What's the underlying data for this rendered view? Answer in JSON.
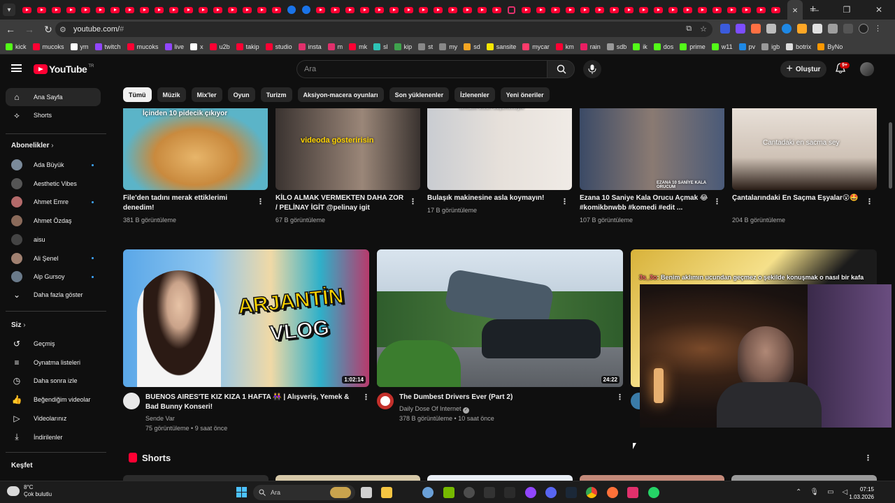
{
  "browser": {
    "url_host": "youtube.com/",
    "url_path": "#",
    "tab_count_favicons": 52,
    "active_tab_close": "×",
    "new_tab": "+",
    "bookmarks": [
      "kick",
      "mucoks",
      "ym",
      "twitch",
      "mucoks",
      "live",
      "x",
      "u2b",
      "takip",
      "studio",
      "insta",
      "m",
      "mk",
      "sl",
      "kip",
      "st",
      "my",
      "sd",
      "sansite",
      "mycar",
      "km",
      "rain",
      "sdb",
      "ik",
      "dos",
      "prime",
      "w11",
      "pv",
      "igb",
      "botrix",
      "ByNo"
    ]
  },
  "header": {
    "logo_text": "YouTube",
    "logo_country": "TR",
    "search_placeholder": "Ara",
    "create_label": "Oluştur",
    "notif_badge": "9+"
  },
  "chips": [
    "Tümü",
    "Müzik",
    "Mix'ler",
    "Oyun",
    "Turizm",
    "Aksiyon-macera oyunları",
    "Son yüklenenler",
    "İzlenenler",
    "Yeni öneriler"
  ],
  "sidebar": {
    "home": "Ana Sayfa",
    "shorts": "Shorts",
    "subs_heading": "Abonelikler",
    "subs": [
      {
        "name": "Ada Büyük",
        "dot": true
      },
      {
        "name": "Aesthetic Vibes",
        "dot": false
      },
      {
        "name": "Ahmet Emre",
        "dot": true
      },
      {
        "name": "Ahmet Özdaş",
        "dot": false
      },
      {
        "name": "aisu",
        "dot": false
      },
      {
        "name": "Ali Şenel",
        "dot": true
      },
      {
        "name": "Alp Gursoy",
        "dot": true
      }
    ],
    "show_more": "Daha fazla göster",
    "you_heading": "Siz",
    "you_items": [
      "Geçmiş",
      "Oynatma listeleri",
      "Daha sonra izle",
      "Beğendiğim videolar",
      "Videolarınız",
      "İndirilenler"
    ],
    "explore_heading": "Keşfet"
  },
  "row1": [
    {
      "title": "File'den tadını merak ettiklerimi denedim!",
      "views": "381 B görüntüleme",
      "overlay": "İçinden 10 pidecik çıkıyor"
    },
    {
      "title": "KİLO ALMAK VERMEKTEN DAHA ZOR / PELİNAY İGİT @pelinay igit",
      "views": "67 B görüntüleme",
      "overlay": "videoda gösteririsin"
    },
    {
      "title": "Bulaşık makinesine asla koymayın!",
      "views": "17 B görüntüleme",
      "overlay": "temizlik olsun duşüncesiyle"
    },
    {
      "title": "Ezana 10 Saniye Kala Orucu Açmak 😂 #komikbnwbb #komedi #edit ...",
      "views": "107 B görüntüleme",
      "overlay": "EZANA 10 SANİYE KALA ORUCUM"
    },
    {
      "title": "Çantalarındaki En Saçma Eşyalar😮🤩",
      "views": "204 B görüntüleme",
      "overlay": "Cantadaki en sacma sey"
    }
  ],
  "row2": [
    {
      "title": "BUENOS AIRES'TE KIZ KIZA 1 HAFTA 👭 | Alışveriş, Yemek & Bad Bunny Konseri!",
      "channel": "Sende Var",
      "meta": "75 görüntüleme • 9 saat önce",
      "duration": "1:02:14",
      "overlay1": "ARJANTİN",
      "overlay2": "VLOG"
    },
    {
      "title": "The Dumbest Drivers Ever (Part 2)",
      "channel": "Daily Dose Of Internet",
      "meta": "378 B görüntüleme • 10 saat önce",
      "duration": "24:22",
      "verified": "✓"
    }
  ],
  "shorts_heading": "Shorts",
  "webcam": {
    "chat_user": "3s_3o",
    "chat_text": ": Benim aklımın ucundan geçmez o şekilde konuşmak o nasıl bir kafa"
  },
  "taskbar": {
    "temp": "8°C",
    "weather": "Çok bulutlu",
    "search": "Ara",
    "time": "07:15",
    "date": "1.03.2026"
  },
  "colors": {
    "bg": "#0f0f0f",
    "chip": "#272727",
    "accent": "#ff0033",
    "link": "#3ea6ff"
  }
}
